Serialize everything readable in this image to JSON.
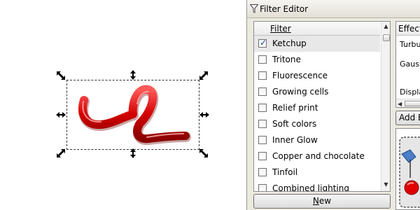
{
  "dock": {
    "title": "Filter Editor",
    "filter_list": {
      "header": "Filter",
      "items": [
        {
          "label": "Ketchup",
          "checked": true,
          "selected": true
        },
        {
          "label": "Tritone",
          "checked": false
        },
        {
          "label": "Fluorescence",
          "checked": false
        },
        {
          "label": "Growing cells",
          "checked": false
        },
        {
          "label": "Relief print",
          "checked": false
        },
        {
          "label": "Soft colors",
          "checked": false
        },
        {
          "label": "Inner Glow",
          "checked": false
        },
        {
          "label": "Copper and chocolate",
          "checked": false
        },
        {
          "label": "Tinfoil",
          "checked": false
        },
        {
          "label": "Combined lighting",
          "checked": false
        }
      ]
    },
    "new_button": {
      "prefix": "",
      "underlined": "N",
      "rest": "ew"
    },
    "effect_pane": {
      "header": "Effect",
      "items": [
        "Turbu",
        "Gauss",
        "Displa"
      ]
    },
    "add_effect_label": "Add E",
    "check_glyph": "✓"
  },
  "canvas": {
    "object_color": "#d40000"
  }
}
